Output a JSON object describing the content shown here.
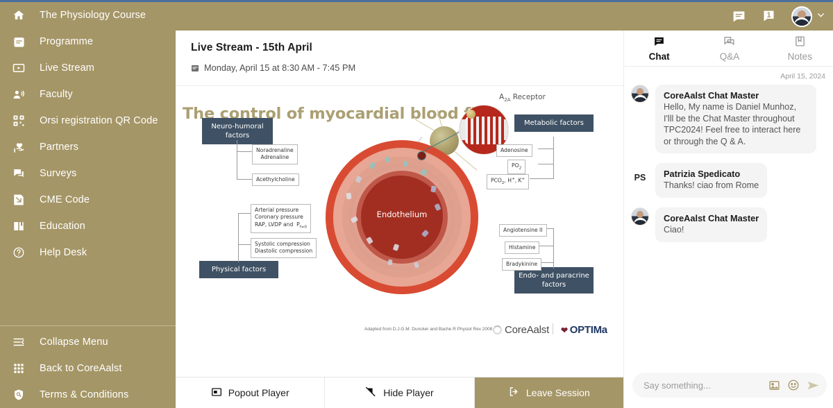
{
  "brand": {
    "sidebar_color": "#a59667",
    "accent_color": "#a59667",
    "top_strip_color": "#4a6f9e"
  },
  "sidebar": {
    "items": [
      {
        "label": "The Physiology Course",
        "icon": "home-icon"
      },
      {
        "label": "Programme",
        "icon": "calendar-icon"
      },
      {
        "label": "Live Stream",
        "icon": "video-icon"
      },
      {
        "label": "Faculty",
        "icon": "speaker-person-icon"
      },
      {
        "label": "Orsi registration QR Code",
        "icon": "qr-code-icon"
      },
      {
        "label": "Partners",
        "icon": "hand-heart-icon"
      },
      {
        "label": "Surveys",
        "icon": "chat-bubbles-icon"
      },
      {
        "label": "CME Code",
        "icon": "certificate-icon"
      },
      {
        "label": "Education",
        "icon": "book-icon"
      },
      {
        "label": "Help Desk",
        "icon": "question-circle-icon"
      }
    ],
    "bottom_items": [
      {
        "label": "Collapse Menu",
        "icon": "collapse-icon"
      },
      {
        "label": "Back to CoreAalst",
        "icon": "grid-apps-icon"
      },
      {
        "label": "Terms & Conditions",
        "icon": "shield-search-icon"
      }
    ]
  },
  "topbar": {
    "messages_icon": "messages-icon",
    "notifications_icon": "notification-bell-icon",
    "notification_count": "1",
    "avatar": "user-avatar",
    "chevron": "chevron-down-icon"
  },
  "session": {
    "title": "Live Stream - 15th April",
    "datetime": "Monday, April 15 at 8:30 AM - 7:45 PM",
    "calendar_icon": "calendar-icon"
  },
  "slide": {
    "title": "The control of myocardial blood flow",
    "center_label": "Endothelium",
    "receptor_label": "A2A Receptor",
    "boxes": {
      "neuro": "Neuro-humoral factors",
      "metabolic": "Metabolic factors",
      "physical": "Physical factors",
      "endo": "Endo- and paracrine factors"
    },
    "neuro_items": [
      "Noradrenaline Adrenaline",
      "Acethylcholine"
    ],
    "metabolic_items": [
      "Adenosine",
      "PO2",
      "PCO2, H+, K+"
    ],
    "physical_items": [
      "Arterial pressure Coronary pressure RAP, LVDP and Pf=0",
      "Systolic compression Diastolic compression"
    ],
    "endo_items": [
      "Angiotensine II",
      "Histamine",
      "Bradykinine"
    ],
    "credit": "Adapted from D.J.G.M. Duncker and Bache R Physiol Rev 2008",
    "logo_core": "CoreAalst",
    "logo_optima": "OPTIMa"
  },
  "player_bar": {
    "popout": {
      "label": "Popout Player",
      "icon": "popout-icon"
    },
    "hide": {
      "label": "Hide Player",
      "icon": "hide-player-icon"
    },
    "leave": {
      "label": "Leave Session",
      "icon": "exit-icon"
    }
  },
  "chat": {
    "tabs": [
      {
        "label": "Chat",
        "icon": "chat-icon",
        "active": true
      },
      {
        "label": "Q&A",
        "icon": "qa-icon",
        "active": false
      },
      {
        "label": "Notes",
        "icon": "notes-icon",
        "active": false
      }
    ],
    "date": "April 15, 2024",
    "messages": [
      {
        "author": "CoreAalst Chat Master",
        "text": "Hello, My name is Daniel Munhoz, I'lll be the Chat Master throughout TPC2024! Feel free to interact here or through the Q & A.",
        "avatar_type": "photo"
      },
      {
        "author": "Patrizia Spedicato",
        "text": "Thanks! ciao from Rome",
        "avatar_type": "initials",
        "initials": "PS"
      },
      {
        "author": "CoreAalst Chat Master",
        "text": "Ciao!",
        "avatar_type": "photo"
      }
    ],
    "input": {
      "placeholder": "Say something...",
      "image_icon": "image-icon",
      "emoji_icon": "emoji-icon",
      "send_icon": "send-icon"
    }
  }
}
